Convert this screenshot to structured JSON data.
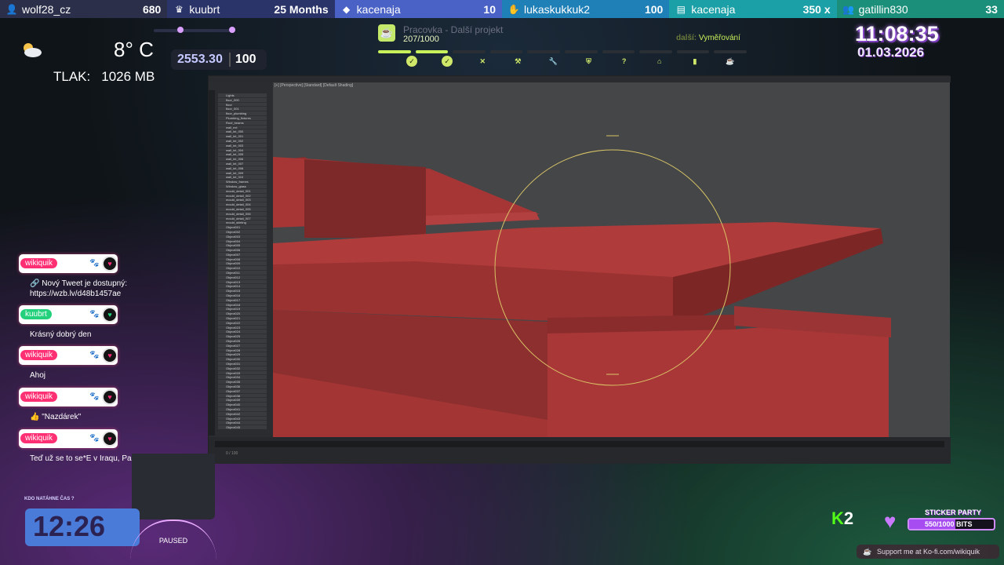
{
  "topbar": [
    {
      "name": "wolf28_cz",
      "value": "680",
      "icon": "add-user-icon",
      "bg": "#2b2f4a",
      "label_color": "#ffffff"
    },
    {
      "name": "kuubrt",
      "value": "25 Months",
      "icon": "crown-icon",
      "bg": "#2a3468"
    },
    {
      "name": "kacenaja",
      "value": "10",
      "icon": "diamond-icon",
      "bg": "#4a62c6"
    },
    {
      "name": "lukaskukkuk2",
      "value": "100",
      "icon": "hand-icon",
      "bg": "#1f7fb7"
    },
    {
      "name": "kacenaja",
      "value": "350 x",
      "icon": "stack-icon",
      "bg": "#1aa0a6"
    },
    {
      "name": "gatillin830",
      "value": "33",
      "icon": "people-icon",
      "bg": "#1c8f7a"
    }
  ],
  "weather": {
    "temp": "8° C",
    "pressure_label": "TLAK:",
    "pressure_value": "1026 MB",
    "icon": "cloud-sun-icon"
  },
  "score": {
    "value": "2553.30",
    "limit": "100"
  },
  "project": {
    "title": "Pracovka - Další projekt",
    "count": "207/1000",
    "next_label": "další:",
    "next_value": "Vyměřování",
    "progress": 0.21,
    "step_icons": [
      "check",
      "check",
      "x",
      "hammer",
      "wrench",
      "shield",
      "question",
      "home",
      "bin",
      "cup"
    ]
  },
  "clock": {
    "time": "11:08:35",
    "date": "01.03.2026"
  },
  "chat": [
    {
      "user": "wikiquik",
      "color": "#ff2f73",
      "text": "🔗 Nový Tweet je dostupný: https://wzb.lv/d48b1457ae"
    },
    {
      "user": "kuubrt",
      "color": "#23d17c",
      "text": "Krásný dobrý den"
    },
    {
      "user": "wikiquik",
      "color": "#ff2f73",
      "text": "Ahoj"
    },
    {
      "user": "wikiquik",
      "color": "#ff2f73",
      "text": "👍 \"Nazdárek\""
    },
    {
      "user": "wikiquik",
      "color": "#ff2f73",
      "text": "Teď už se to se*E v Iraqu, Pakistanu"
    }
  ],
  "timer": {
    "label": "KDO NATÁHNE ČAS ?",
    "time": "12:26",
    "paused": "PAUSED"
  },
  "kick": {
    "k": "K",
    "n": "2"
  },
  "sticker": {
    "title": "STICKER PARTY",
    "bits": "550/1000 BITS",
    "progress": 0.55
  },
  "kofi": "Support me at Ko-fi.com/wikiquik",
  "outliner_items": [
    "Lights",
    "floor_000",
    "floor",
    "floor_001",
    "floor_plumbing",
    "Plumbing_fixtures",
    "Roof_beams",
    "wall_ext",
    "wall_int_000",
    "wall_int_001",
    "wall_int_002",
    "wall_int_003",
    "wall_int_004",
    "wall_int_005",
    "wall_int_006",
    "wall_int_007",
    "wall_int_008",
    "wall_int_009",
    "wall_int_010",
    "Window_frames",
    "Window_glass",
    "mould_detail_001",
    "mould_detail_002",
    "mould_detail_003",
    "mould_detail_004",
    "mould_detail_005",
    "mould_detail_006",
    "mould_detail_007",
    "mould_skirting",
    "Object001",
    "Object002",
    "Object003",
    "Object004",
    "Object005",
    "Object006",
    "Object007",
    "Object008",
    "Object009",
    "Object010",
    "Object011",
    "Object012",
    "Object013",
    "Object014",
    "Object015",
    "Object016",
    "Object017",
    "Object018",
    "Object019",
    "Object020",
    "Object021",
    "Object022",
    "Object023",
    "Object024",
    "Object025",
    "Object026",
    "Object027",
    "Object028",
    "Object029",
    "Object030",
    "Object031",
    "Object032",
    "Object033",
    "Object034",
    "Object035",
    "Object036",
    "Object037",
    "Object038",
    "Object039",
    "Object040",
    "Object041",
    "Object042",
    "Object043",
    "Object044",
    "Object045",
    "Object046",
    "Object047",
    "Object048",
    "Object049",
    "Object050",
    "Object051",
    "Object052",
    "Object053"
  ],
  "viewport_label": "[+] [Perspective] [Standard] [Default Shading]",
  "timeline_status": "0 / 100"
}
